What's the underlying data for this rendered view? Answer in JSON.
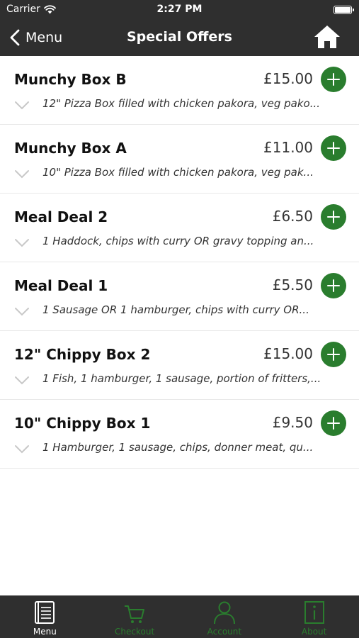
{
  "status_bar": {
    "carrier": "Carrier",
    "time": "2:27 PM"
  },
  "nav": {
    "back_label": "Menu",
    "title": "Special Offers"
  },
  "items": [
    {
      "name": "Munchy Box B",
      "price": "£15.00",
      "description": "12\" Pizza Box filled with chicken pakora, veg pako..."
    },
    {
      "name": "Munchy Box A",
      "price": "£11.00",
      "description": "10\" Pizza Box filled with chicken pakora, veg pak..."
    },
    {
      "name": "Meal Deal 2",
      "price": "£6.50",
      "description": "1 Haddock, chips with curry OR gravy topping an..."
    },
    {
      "name": "Meal Deal 1",
      "price": "£5.50",
      "description": "1 Sausage OR 1 hamburger, chips with curry OR..."
    },
    {
      "name": "12\" Chippy Box 2",
      "price": "£15.00",
      "description": "1 Fish, 1 hamburger, 1 sausage, portion of fritters,..."
    },
    {
      "name": "10\" Chippy Box 1",
      "price": "£9.50",
      "description": "1 Hamburger, 1 sausage, chips, donner meat, qu..."
    }
  ],
  "tabs": [
    {
      "label": "Menu",
      "icon": "menu-book-icon",
      "active": true
    },
    {
      "label": "Checkout",
      "icon": "cart-icon",
      "active": false
    },
    {
      "label": "Account",
      "icon": "person-icon",
      "active": false
    },
    {
      "label": "About",
      "icon": "info-icon",
      "active": false
    }
  ],
  "colors": {
    "bar_background": "#2f2f2f",
    "accent_green": "#2a7d2e",
    "text_white": "#ffffff"
  }
}
